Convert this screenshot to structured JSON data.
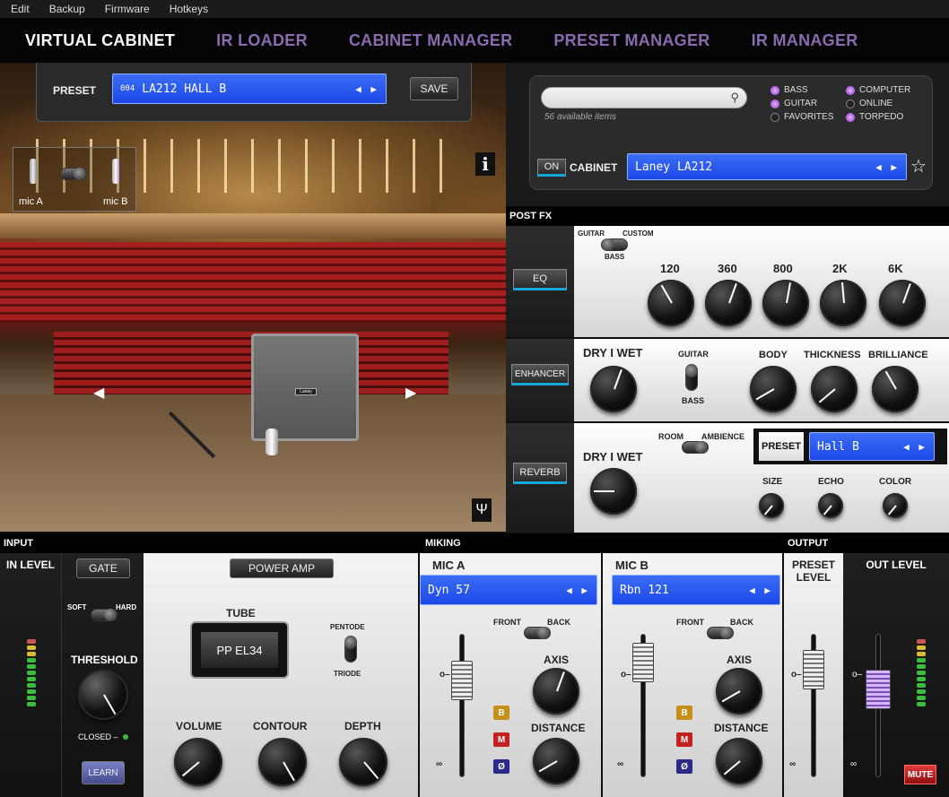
{
  "menu": [
    "Edit",
    "Backup",
    "Firmware",
    "Hotkeys"
  ],
  "nav": [
    "VIRTUAL CABINET",
    "IR LOADER",
    "CABINET MANAGER",
    "PRESET MANAGER",
    "IR MANAGER"
  ],
  "stage": {
    "preset_label": "PRESET",
    "preset_number": "004",
    "preset_name": "LA212 HALL B",
    "save": "SAVE",
    "mic_a": "mic A",
    "mic_b": "mic B",
    "info": "i",
    "cab_logo": "Laney"
  },
  "library": {
    "search_placeholder": "",
    "count": "56 available items",
    "filters": [
      {
        "label": "BASS",
        "on": true
      },
      {
        "label": "COMPUTER",
        "on": true
      },
      {
        "label": "GUITAR",
        "on": true
      },
      {
        "label": "ONLINE",
        "on": false
      },
      {
        "label": "FAVORITES",
        "on": false
      },
      {
        "label": "TORPEDO",
        "on": true
      }
    ],
    "on_label": "ON",
    "cabinet_label": "CABINET",
    "cabinet_name": "Laney LA212"
  },
  "postfx": {
    "header": "POST FX",
    "eq": {
      "button": "EQ",
      "mode_left": "GUITAR",
      "mode_right": "CUSTOM",
      "mode_bottom": "BASS",
      "bands": [
        "120",
        "360",
        "800",
        "2K",
        "6K"
      ]
    },
    "enhancer": {
      "button": "ENHANCER",
      "drywet": "DRY I WET",
      "sw_top": "GUITAR",
      "sw_bottom": "BASS",
      "knobs": [
        "BODY",
        "THICKNESS",
        "BRILLIANCE"
      ]
    },
    "reverb": {
      "button": "REVERB",
      "mode_left": "ROOM",
      "mode_right": "AMBIENCE",
      "drywet": "DRY I WET",
      "preset_label": "PRESET",
      "preset_name": "Hall B",
      "knobs": [
        "SIZE",
        "ECHO",
        "COLOR"
      ]
    }
  },
  "input": {
    "header": "INPUT",
    "in_level": "IN LEVEL",
    "gate": "GATE",
    "soft": "SOFT",
    "hard": "HARD",
    "threshold": "THRESHOLD",
    "closed": "CLOSED –",
    "learn": "LEARN"
  },
  "power_amp": {
    "title": "POWER AMP",
    "tube_label": "TUBE",
    "tube_name": "PP EL34",
    "pentode": "PENTODE",
    "triode": "TRIODE",
    "knobs": [
      "VOLUME",
      "CONTOUR",
      "DEPTH"
    ]
  },
  "miking": {
    "header": "MIKING",
    "mic_a": {
      "title": "MIC A",
      "model": "Dyn 57",
      "front": "FRONT",
      "back": "BACK",
      "axis": "AXIS",
      "distance": "DISTANCE"
    },
    "mic_b": {
      "title": "MIC B",
      "model": "Rbn 121",
      "front": "FRONT",
      "back": "BACK",
      "axis": "AXIS",
      "distance": "DISTANCE"
    },
    "bm": [
      "B",
      "M",
      "Ø"
    ]
  },
  "output": {
    "header": "OUTPUT",
    "preset_level": "PRESET LEVEL",
    "out_level": "OUT LEVEL",
    "mute": "MUTE"
  },
  "colors": {
    "accent": "#8a6bb0",
    "lcd": "#2a5cf0",
    "led_green": "#3dbb3d",
    "fx_underline": "#17a6d8",
    "mute": "#c62020"
  }
}
